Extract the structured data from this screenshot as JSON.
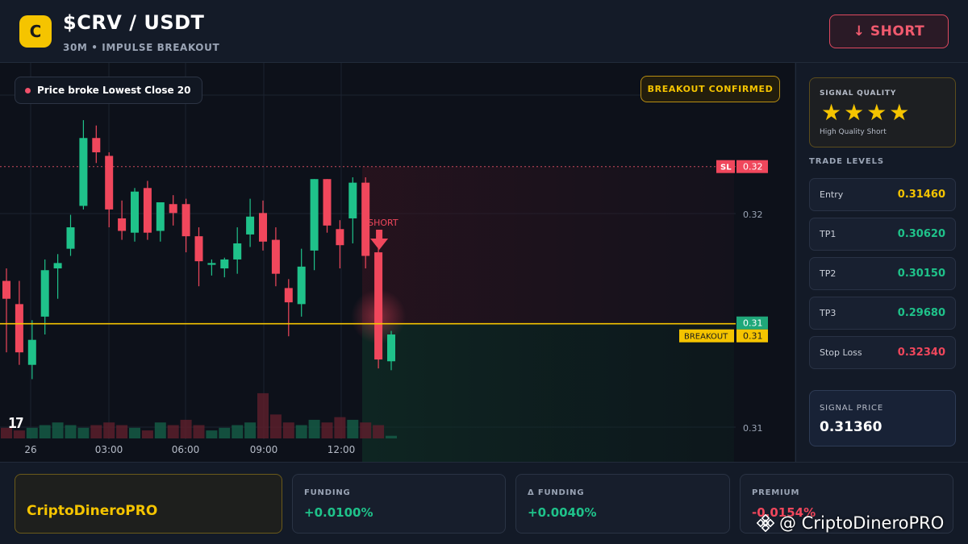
{
  "header": {
    "coin_letter": "C",
    "title": "$CRV / USDT",
    "subtitle": "30M • IMPULSE BREAKOUT",
    "short_button": "↓ SHORT"
  },
  "chart": {
    "alert_text": "Price broke Lowest Close 20",
    "breakout_badge": "BREAKOUT CONFIRMED",
    "tv_logo": "17",
    "short_marker": "SHORT",
    "sl_tag": "SL",
    "sl_value": "0.32",
    "price_tag": "0.31",
    "breakout_tag": "BREAKOUT",
    "breakout_value": "0.31"
  },
  "chart_data": {
    "type": "candlestick",
    "x_ticks": [
      "26",
      "03:00",
      "06:00",
      "09:00",
      "12:00"
    ],
    "y_ticks": [
      "0.32",
      "0.31"
    ],
    "candles": [
      {
        "o": 0.317,
        "h": 0.3177,
        "l": 0.313,
        "c": 0.316
      },
      {
        "o": 0.3157,
        "h": 0.317,
        "l": 0.3123,
        "c": 0.313
      },
      {
        "o": 0.3123,
        "h": 0.3148,
        "l": 0.3115,
        "c": 0.3137
      },
      {
        "o": 0.315,
        "h": 0.3182,
        "l": 0.314,
        "c": 0.3176
      },
      {
        "o": 0.3177,
        "h": 0.3185,
        "l": 0.316,
        "c": 0.318
      },
      {
        "o": 0.3188,
        "h": 0.3207,
        "l": 0.3184,
        "c": 0.32
      },
      {
        "o": 0.3212,
        "h": 0.326,
        "l": 0.321,
        "c": 0.325
      },
      {
        "o": 0.325,
        "h": 0.3257,
        "l": 0.3236,
        "c": 0.3242
      },
      {
        "o": 0.324,
        "h": 0.3242,
        "l": 0.32,
        "c": 0.321
      },
      {
        "o": 0.3205,
        "h": 0.3215,
        "l": 0.3193,
        "c": 0.3198
      },
      {
        "o": 0.3197,
        "h": 0.3222,
        "l": 0.3192,
        "c": 0.322
      },
      {
        "o": 0.3222,
        "h": 0.3226,
        "l": 0.3193,
        "c": 0.3197
      },
      {
        "o": 0.3198,
        "h": 0.3212,
        "l": 0.3192,
        "c": 0.3214
      },
      {
        "o": 0.3213,
        "h": 0.3218,
        "l": 0.3201,
        "c": 0.3208
      },
      {
        "o": 0.3213,
        "h": 0.3216,
        "l": 0.3186,
        "c": 0.3195
      },
      {
        "o": 0.3195,
        "h": 0.32,
        "l": 0.3167,
        "c": 0.3181
      },
      {
        "o": 0.3179,
        "h": 0.3182,
        "l": 0.3173,
        "c": 0.318
      },
      {
        "o": 0.3177,
        "h": 0.3183,
        "l": 0.3172,
        "c": 0.3182
      },
      {
        "o": 0.3182,
        "h": 0.32,
        "l": 0.3174,
        "c": 0.3191
      },
      {
        "o": 0.3196,
        "h": 0.3216,
        "l": 0.3189,
        "c": 0.3206
      },
      {
        "o": 0.3208,
        "h": 0.3215,
        "l": 0.3187,
        "c": 0.3192
      },
      {
        "o": 0.3193,
        "h": 0.32,
        "l": 0.3167,
        "c": 0.3174
      },
      {
        "o": 0.3166,
        "h": 0.3171,
        "l": 0.3139,
        "c": 0.3158
      },
      {
        "o": 0.3157,
        "h": 0.3188,
        "l": 0.315,
        "c": 0.3178
      },
      {
        "o": 0.3187,
        "h": 0.3227,
        "l": 0.3176,
        "c": 0.3227
      },
      {
        "o": 0.3227,
        "h": 0.3227,
        "l": 0.3197,
        "c": 0.3201
      },
      {
        "o": 0.3199,
        "h": 0.3204,
        "l": 0.3177,
        "c": 0.319
      },
      {
        "o": 0.3205,
        "h": 0.3228,
        "l": 0.3191,
        "c": 0.3225
      },
      {
        "o": 0.3225,
        "h": 0.3228,
        "l": 0.3177,
        "c": 0.3184
      },
      {
        "o": 0.3186,
        "h": 0.3193,
        "l": 0.3121,
        "c": 0.3126
      },
      {
        "o": 0.3125,
        "h": 0.3142,
        "l": 0.312,
        "c": 0.314
      }
    ],
    "volume": [
      4,
      3,
      4,
      5,
      6,
      5,
      4,
      5,
      6,
      5,
      4,
      3,
      6,
      5,
      7,
      5,
      3,
      4,
      5,
      6,
      17,
      9,
      6,
      5,
      7,
      6,
      8,
      7,
      6,
      5,
      1
    ],
    "stop_loss": 0.3234,
    "breakout_level": 0.3146
  },
  "side": {
    "quality_label": "SIGNAL QUALITY",
    "stars": "★★★★",
    "quality_sub": "High Quality Short",
    "levels_title": "TRADE LEVELS",
    "levels": [
      {
        "name": "Entry",
        "value": "0.31460"
      },
      {
        "name": "TP1",
        "value": "0.30620"
      },
      {
        "name": "TP2",
        "value": "0.30150"
      },
      {
        "name": "TP3",
        "value": "0.29680"
      },
      {
        "name": "Stop Loss",
        "value": "0.32340"
      }
    ],
    "signal_label": "SIGNAL PRICE",
    "signal_value": "0.31360"
  },
  "footer": {
    "brand": "CriptoDineroPRO",
    "stats": [
      {
        "label": "FUNDING",
        "value": "+0.0100%"
      },
      {
        "label": "Δ FUNDING",
        "value": "+0.0040%"
      },
      {
        "label": "PREMIUM",
        "value": "-0.0154%"
      }
    ],
    "watermark": "@ CriptoDineroPRO"
  },
  "colors": {
    "up": "#1fc28a",
    "down": "#f0475c",
    "accent": "#f5c400",
    "entry": "#f5c400",
    "tp": "#1fc28a",
    "stop": "#f0475c"
  }
}
